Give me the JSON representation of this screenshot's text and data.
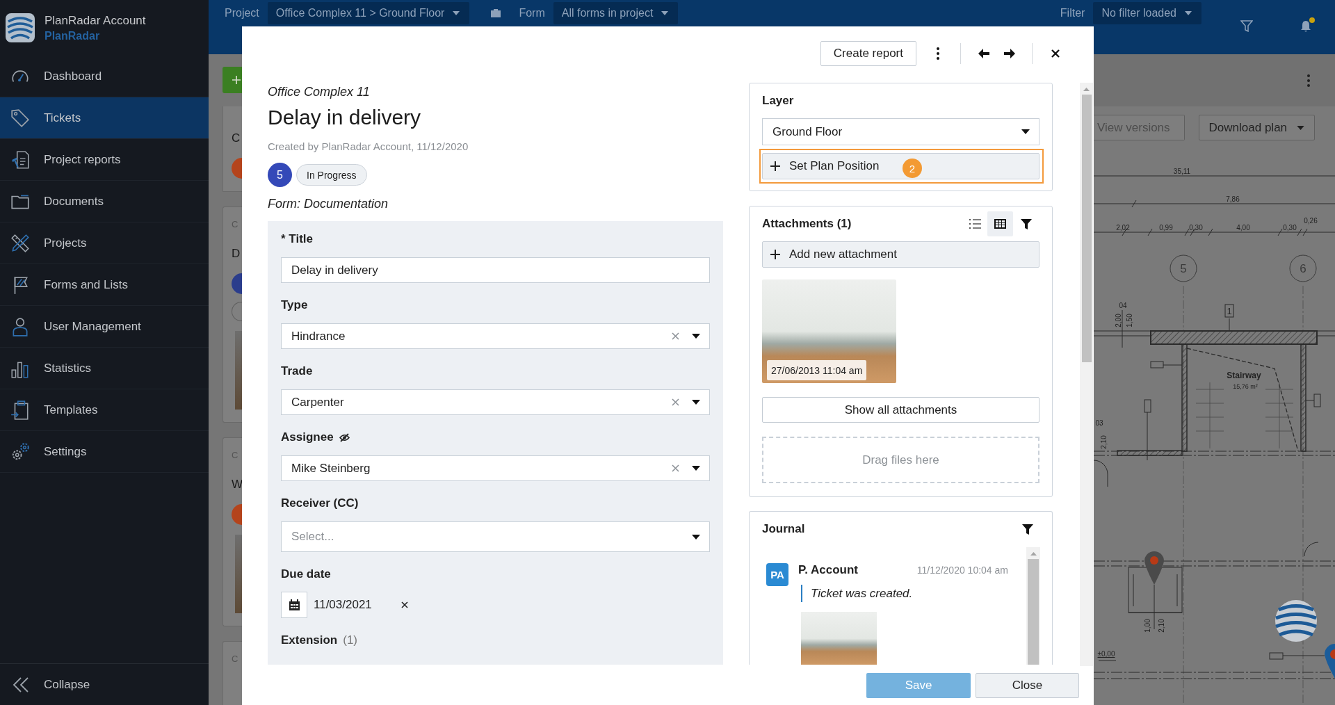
{
  "sidebar": {
    "account": "PlanRadar Account",
    "brand": "PlanRadar",
    "items": [
      {
        "label": "Dashboard",
        "selected": false
      },
      {
        "label": "Tickets",
        "selected": true
      },
      {
        "label": "Project reports",
        "selected": false
      },
      {
        "label": "Documents",
        "selected": false
      },
      {
        "label": "Projects",
        "selected": false
      },
      {
        "label": "Forms and Lists",
        "selected": false
      },
      {
        "label": "User Management",
        "selected": false
      },
      {
        "label": "Statistics",
        "selected": false
      },
      {
        "label": "Templates",
        "selected": false
      },
      {
        "label": "Settings",
        "selected": false
      }
    ],
    "collapse": "Collapse"
  },
  "topbar": {
    "project_label": "Project",
    "project": "Office Complex 11 > Ground Floor",
    "form_label": "Form",
    "form": "All forms in project",
    "filter_label": "Filter",
    "filter": "No filter loaded",
    "unread_notifications": true
  },
  "ticket_list": {
    "cards": [
      {
        "title": "C",
        "color": "#b4441c",
        "pill": false,
        "photo": false
      },
      {
        "label": "C",
        "title": "D",
        "color": "#2b3d8c",
        "pill": true,
        "photo": true
      },
      {
        "label": "C",
        "title": "W",
        "color": "#b4441c",
        "pill": false,
        "photo": true
      },
      {
        "label": "C",
        "pill": false,
        "photo": false
      }
    ]
  },
  "plan": {
    "buttons": [
      {
        "label": "View versions",
        "kind": "plain",
        "disabled": true
      },
      {
        "label": "Download plan",
        "kind": "dropdown",
        "disabled": false
      }
    ],
    "labels": [
      {
        "text": "35,11",
        "kind": "dimension"
      },
      {
        "text": "7,86",
        "kind": "dimension"
      },
      {
        "text": "0,26",
        "kind": "dimension"
      },
      {
        "text": "2,02",
        "kind": "dimension"
      },
      {
        "text": "0,99",
        "kind": "dimension"
      },
      {
        "text": "0,30",
        "kind": "dimension"
      },
      {
        "text": "4,00",
        "kind": "dimension"
      },
      {
        "text": "0,30",
        "kind": "dimension"
      },
      {
        "text": "5",
        "kind": "axis"
      },
      {
        "text": "6",
        "kind": "axis"
      },
      {
        "text": "04",
        "kind": "dimension"
      },
      {
        "text": "2,00",
        "kind": "dimension"
      },
      {
        "text": "1,50",
        "kind": "dimension"
      },
      {
        "text": "1",
        "kind": "tag"
      },
      {
        "text": "Stairway",
        "kind": "room"
      },
      {
        "text": "15,76 m²",
        "kind": "area"
      },
      {
        "text": "03",
        "kind": "dimension"
      },
      {
        "text": "2,10",
        "kind": "dimension"
      },
      {
        "text": "1,00",
        "kind": "dimension"
      },
      {
        "text": "2,10",
        "kind": "dimension"
      },
      {
        "text": "±0,00",
        "kind": "level"
      }
    ],
    "pins": [
      {
        "color": "#4a4a4a"
      },
      {
        "color": "#1b5c9a"
      }
    ]
  },
  "modal": {
    "header": {
      "create_report": "Create report"
    },
    "project": "Office Complex 11",
    "title": "Delay in delivery",
    "created": "Created by PlanRadar Account, 11/12/2020",
    "number": "5",
    "status": "In Progress",
    "form": "Form: Documentation",
    "fields": [
      {
        "kind": "text",
        "label": "* Title",
        "value": "Delay in delivery",
        "clearable": false,
        "private": false
      },
      {
        "kind": "select",
        "label": "Type",
        "value": "Hindrance",
        "clearable": true,
        "private": false
      },
      {
        "kind": "select",
        "label": "Trade",
        "value": "Carpenter",
        "clearable": true,
        "private": false
      },
      {
        "kind": "select",
        "label": "Assignee",
        "value": "Mike Steinberg",
        "clearable": true,
        "private": true
      },
      {
        "kind": "multiselect",
        "label": "Receiver (CC)",
        "placeholder": "Select...",
        "clearable": false,
        "private": false
      },
      {
        "kind": "date",
        "label": "Due date",
        "value": "11/03/2021",
        "clearable": true,
        "private": false
      },
      {
        "kind": "extension",
        "label": "Extension",
        "count": "(1)",
        "private": false
      }
    ],
    "layer": {
      "title": "Layer",
      "value": "Ground Floor",
      "set_position": "Set Plan Position",
      "highlighted": true,
      "step": "2"
    },
    "attachments": {
      "title": "Attachments (1)",
      "views": [
        {
          "kind": "list",
          "selected": false
        },
        {
          "kind": "grid",
          "selected": true
        }
      ],
      "add": "Add new attachment",
      "photos": [
        {
          "date": "27/06/2013 11:04 am"
        }
      ],
      "show_all": "Show all attachments",
      "drop_hint": "Drag files here"
    },
    "journal": {
      "title": "Journal",
      "entries": [
        {
          "initials": "PA",
          "author": "P. Account",
          "time": "11/12/2020 10:04 am",
          "text": "Ticket was created.",
          "photo": true
        }
      ]
    },
    "footer": {
      "save": "Save",
      "close": "Close",
      "save_enabled": false
    }
  }
}
